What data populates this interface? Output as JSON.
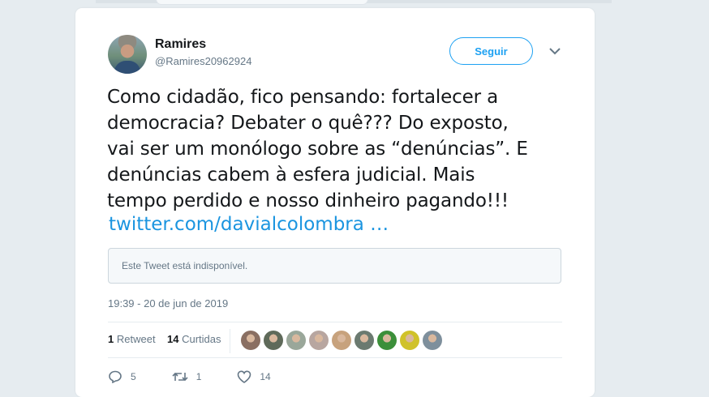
{
  "tweet": {
    "author_name": "Ramires",
    "author_handle": "@Ramires20962924",
    "follow_label": "Seguir",
    "text": "Como cidadão, fico pensando: fortalecer a\ndemocracia? Debater  o quê??? Do exposto,\nvai ser um monólogo sobre as “denúncias”. E\ndenúncias cabem à esfera judicial. Mais\ntempo perdido e nosso dinheiro pagando!!!",
    "link_text": "twitter.com/davialcolombra …",
    "quote_unavailable": "Este Tweet está indisponível.",
    "timestamp": "19:39 - 20 de jun de 2019"
  },
  "stats": {
    "retweets_count": "1",
    "retweets_label": "Retweet",
    "likes_count": "14",
    "likes_label": "Curtidas",
    "liker_avatar_colors": [
      "#8a6f62",
      "#5f6a5a",
      "#9aa79a",
      "#b8a6a0",
      "#c7a27d",
      "#6b7a70",
      "#3c8f3a",
      "#d0c22a",
      "#7e8f9c"
    ]
  },
  "actions": {
    "reply_count": "5",
    "retweet_count": "1",
    "like_count": "14"
  },
  "colors": {
    "accent": "#1da1f2",
    "link": "#1b95e0",
    "muted": "#657786"
  }
}
